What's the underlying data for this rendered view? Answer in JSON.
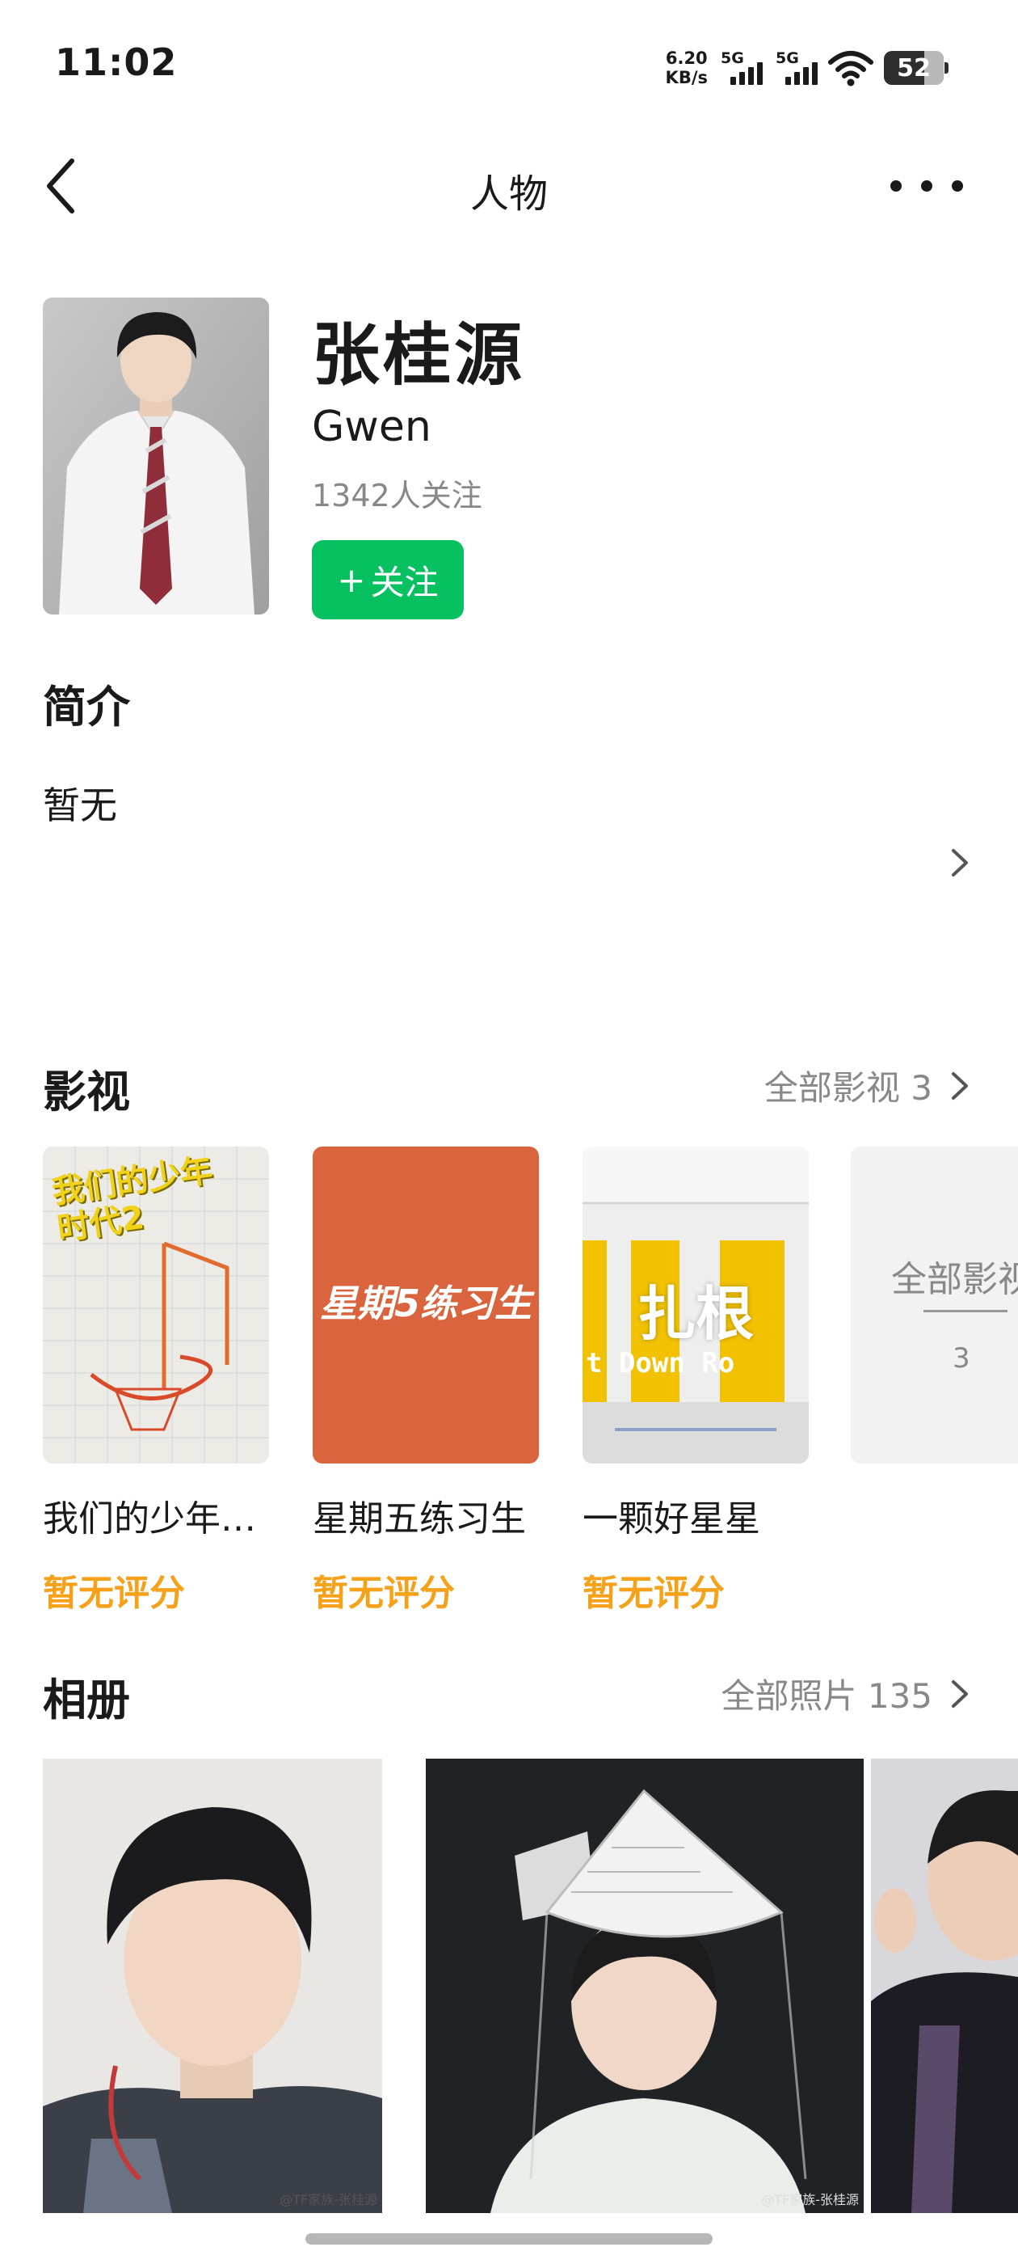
{
  "status_bar": {
    "time": "11:02",
    "net_speed_value": "6.20",
    "net_speed_unit": "KB/s",
    "signal1_label": "5G",
    "signal2_label": "5G",
    "battery": "52"
  },
  "nav": {
    "title": "人物",
    "back_icon": "chevron-left-icon",
    "more_icon": "more-icon"
  },
  "profile": {
    "name": "张桂源",
    "english_name": "Gwen",
    "followers": "1342人关注",
    "follow_button": "关注",
    "follow_button_icon": "+"
  },
  "intro": {
    "title": "简介",
    "text": "暂无"
  },
  "films": {
    "title": "影视",
    "all_label": "全部影视 3",
    "items": [
      {
        "title": "我们的少年…",
        "score": "暂无评分",
        "poster_text": "我们的少年时代2"
      },
      {
        "title": "星期五练习生",
        "score": "暂无评分",
        "poster_text": "星期5练习生"
      },
      {
        "title": "一颗好星星",
        "score": "暂无评分",
        "poster_text": "扎根",
        "poster_subtext": "t Down Ro"
      }
    ],
    "all_card_label": "全部影视",
    "all_card_count": "3"
  },
  "album": {
    "title": "相册",
    "all_label": "全部照片 135",
    "watermark_1": "@TF家族-张桂源",
    "watermark_2": "@TF家族-张桂源"
  },
  "colors": {
    "accent_green": "#07c160",
    "score_orange": "#f5a21a",
    "secondary_text": "#888888"
  }
}
